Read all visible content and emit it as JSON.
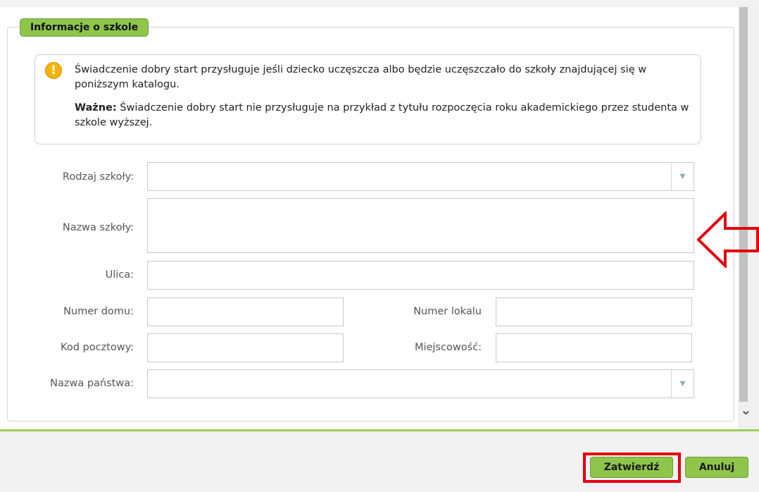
{
  "section": {
    "legend": "Informacje o szkole"
  },
  "info": {
    "icon": "warning-icon",
    "line1": "Świadczenie dobry start przysługuje jeśli dziecko uczęszcza albo będzie uczęszczało do szkoły znajdującej się w poniższym katalogu.",
    "important_label": "Ważne:",
    "line2": "Świadczenie dobry start nie przysługuje na przykład z tytułu rozpoczęcia roku akademickiego przez studenta w szkole wyższej."
  },
  "form": {
    "school_type_label": "Rodzaj szkoły:",
    "school_type_value": "",
    "school_name_label": "Nazwa szkoły:",
    "school_name_value": "",
    "street_label": "Ulica:",
    "street_value": "",
    "house_number_label": "Numer domu:",
    "house_number_value": "",
    "apartment_number_label": "Numer lokalu",
    "apartment_number_value": "",
    "postal_code_label": "Kod pocztowy:",
    "postal_code_value": "",
    "city_label": "Miejscowość:",
    "city_value": "",
    "country_label": "Nazwa państwa:",
    "country_value": ""
  },
  "buttons": {
    "confirm": "Zatwierdź",
    "cancel": "Anuluj"
  },
  "colors": {
    "accent_green": "#8fc54a",
    "annotation_red": "#e3000f",
    "warning_yellow": "#f4b40a"
  }
}
